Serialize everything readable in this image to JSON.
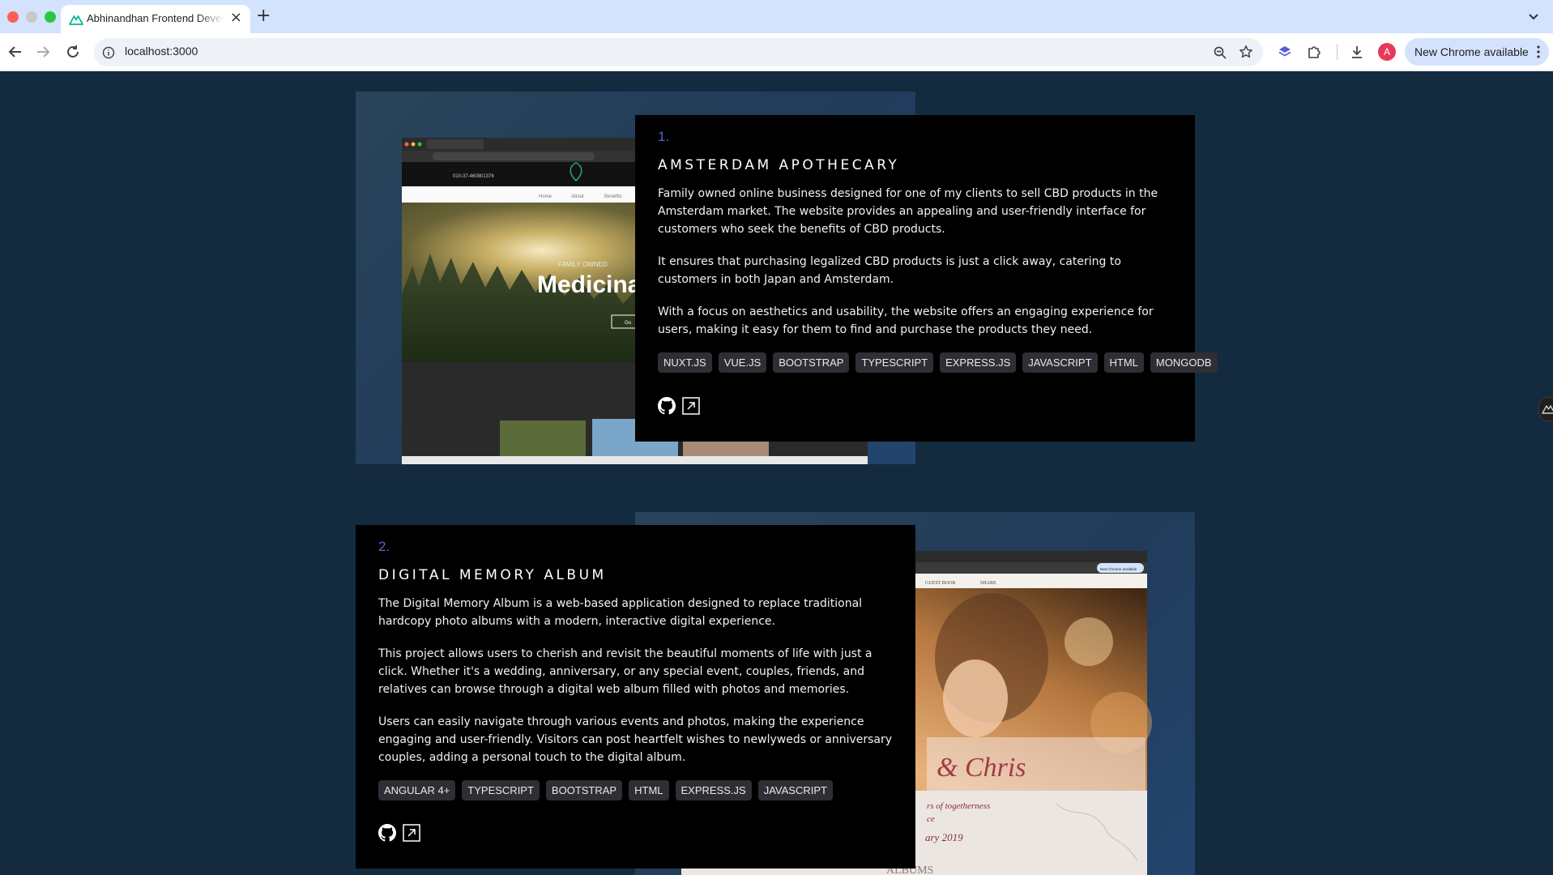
{
  "browser": {
    "tab_title": "Abhinandhan Frontend Developer",
    "url": "localhost:3000",
    "avatar_letter": "A",
    "update_label": "New Chrome available"
  },
  "projects": [
    {
      "number": "1.",
      "title": "AMSTERDAM APOTHECARY",
      "description": [
        "Family owned online business designed for one of my clients to sell CBD products in the Amsterdam market. The website provides an appealing and user-friendly interface for customers who seek the benefits of CBD products.",
        "It ensures that purchasing legalized CBD products is just a click away, catering to customers in both Japan and Amsterdam.",
        "With a focus on aesthetics and usability, the website offers an engaging experience for users, making it easy for them to find and purchase the products they need."
      ],
      "tags": [
        "NUXT.JS",
        "VUE.JS",
        "BOOTSTRAP",
        "TYPESCRIPT",
        "EXPRESS.JS",
        "JAVASCRIPT",
        "HTML",
        "MONGODB"
      ],
      "screenshot": {
        "hero_text": "Medicinal",
        "nav_items": [
          "Home",
          "About",
          "Benefits"
        ],
        "phone": "010-37-460801376",
        "kicker": "FAMILY OWNED",
        "cta": "Go"
      }
    },
    {
      "number": "2.",
      "title": "DIGITAL MEMORY ALBUM",
      "description": [
        "The Digital Memory Album is a web-based application designed to replace traditional hardcopy photo albums with a modern, interactive digital experience.",
        "This project allows users to cherish and revisit the beautiful moments of life with just a click. Whether it's a wedding, anniversary, or any special event, couples, friends, and relatives can browse through a digital web album filled with photos and memories.",
        "Users can easily navigate through various events and photos, making the experience engaging and user-friendly. Visitors can post heartfelt wishes to newlyweds or anniversary couples, adding a personal touch to the digital album."
      ],
      "tags": [
        "ANGULAR 4+",
        "TYPESCRIPT",
        "BOOTSTRAP",
        "HTML",
        "EXPRESS.JS",
        "JAVASCRIPT"
      ],
      "screenshot": {
        "nav_items": [
          "GUEST BOOK",
          "SHARE"
        ],
        "update_chip": "New Chrome available",
        "script_name": "& Chris",
        "years_line": "rs of togetherness",
        "date_a": "ce",
        "date_b": "ary 2019",
        "albums_heading": "ALBUMS"
      }
    }
  ],
  "colors": {
    "page_bg": "#142a3e",
    "card_bg": "#000000",
    "accent_number": "#5a62c8",
    "tag_bg": "#2e2e35"
  }
}
